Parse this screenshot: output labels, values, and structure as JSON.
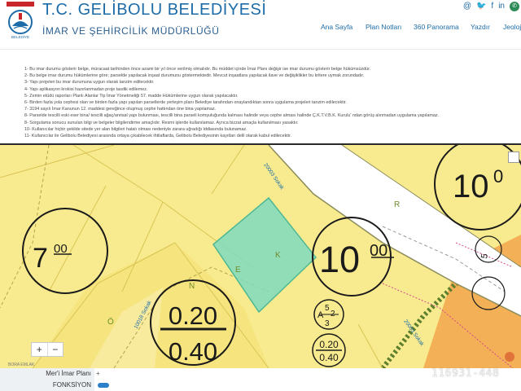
{
  "header": {
    "title": "T.C. GELİBOLU BELEDİYESİ",
    "subtitle": "İMAR VE ŞEHİRCİLİK MÜDÜRLÜĞÜ",
    "logo_text": "BELEDİYE",
    "social_icons": [
      "email-icon",
      "twitter-icon",
      "facebook-icon",
      "linkedin-icon",
      "whatsapp-icon"
    ],
    "nav": [
      "Ana Sayfa",
      "Plan Notları",
      "360 Panorama",
      "Yazdır",
      "Jeoloji"
    ]
  },
  "notes": [
    "1- Bu imar durumu gösterir belge, müracaat tarihinden önce azami bir yıl önce verilmiş olmalıdır. Bu müddet içinde İmar Planı değişir ise imar durumu gösterir belge hükümsüzdür.",
    "2- Bu belge imar durumu hükümlerine göre; parselde yapılacak inşaat durumunu göstermektedir. Mevcut inşaatlara yapılacak ilave ve değişiklikler bu kritere uymak zorundadır.",
    "3- Yapı projeleri bu imar durumuna uygun olarak tanzim edilecektir.",
    "4- Yapı aplikasyon krokisi hazırlanmadan proje tasdik edilemez.",
    "5- Zemin etüdü raporları Planlı Alanlar Tip İmar Yönetmeliği 57. madde Hükümlerine uygun olarak yapılacaktır.",
    "6- Birden fazla yola cephesi olan ve birden fazla yapı yapılan parsellerde yerleşim planı Belediye tarafından onaylandıktan sonra uygulama projeleri tanzim edilecektir.",
    "7- 3194 sayılı İmar Kanunun 12. maddesi gereğince oluşmuş cephe hattından öne bina yapılamaz.",
    "8- Parselde tescilli eski eser bina/ tescilli ağaç/anıtsal yapı bulunması, tescilli bina parseli komşuluğunda kalması halinde veya cephe alması halinde Ç.K.T.V.B.K. Kurulu' ndan görüş alınmadan uygulama yapılamaz.",
    "8- Sorgulama sonucu sunulan bilgi ve belgeler bilgilendirme amaçlıdır. Resmi işlerde kullanılamaz. Ayrıca bizzat amaçla kullanılması yasaktır.",
    "10- Kullanıcılar hiçbir şekilde sitede yer alan bilgileri hatalı olması nedeniyle zarara uğradığı iddiasında bulunamaz.",
    "11- Kullanıcılar ile Gelibolu Belediyesi arasında ortaya çıkabilecek ihtilaflarda, Gelibolu Belediyesinin kayıtları delil olarak kabul edilecektir."
  ],
  "map": {
    "labels": {
      "left_height": "7",
      "left_height_sup": "00",
      "right_height": "10",
      "right_height_sup": "00",
      "top_right_height": "10",
      "top_right_height_sup": "0",
      "ratio_top": "0.20",
      "ratio_bottom": "0.40",
      "small_ratio_top": "0.20",
      "small_ratio_bottom": "0.40",
      "small_a": "A",
      "small_num1": "5",
      "small_num2": "2",
      "small_num3": "3",
      "street1": "20003 Sokak",
      "street2": "20003 Sokak",
      "street3": "10018 Sokak",
      "road_letters": [
        "Ö",
        "N",
        "E",
        "K",
        "R"
      ],
      "plot_letters": [
        "E",
        "K"
      ],
      "right_small": "5"
    },
    "zoom_in": "+",
    "zoom_out": "−"
  },
  "info": {
    "rows": [
      {
        "label": "Mer'i İmar Planı",
        "value": "+"
      },
      {
        "label": "FONKSİYON",
        "value": ""
      }
    ],
    "watermark": "116931-448",
    "brand": "BORA EMLAK"
  },
  "colors": {
    "brand_blue": "#1d6ca8",
    "map_yellow": "#f8eb8f",
    "selected_parcel": "#7fdbbe",
    "orange_zone": "#f3b056"
  }
}
